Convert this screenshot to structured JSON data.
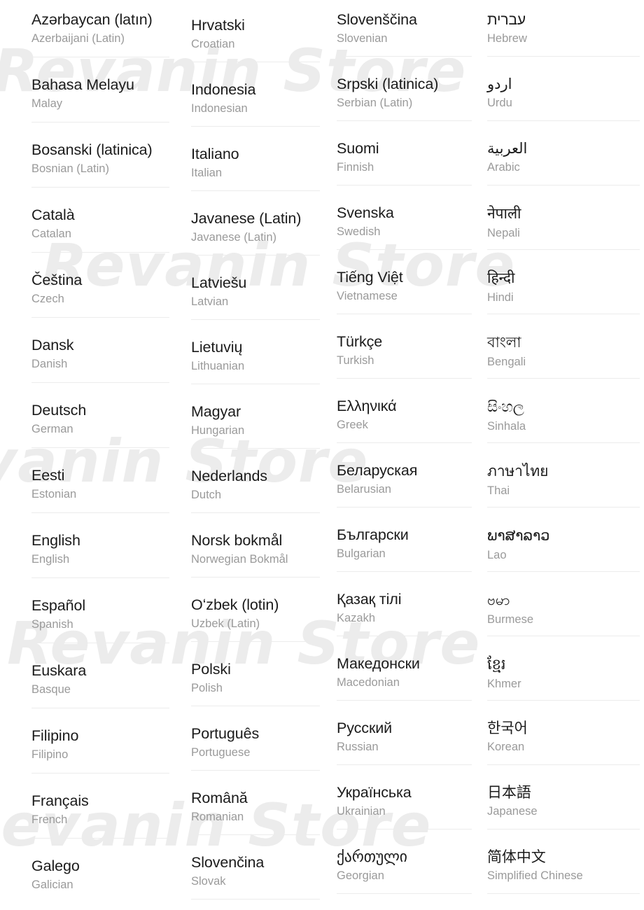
{
  "screen": {
    "title": "Language selection list",
    "watermark_text": "Revanin Store",
    "colors": {
      "background": "#ffffff",
      "native_text": "#1b1b1b",
      "english_text": "#9a9a9a",
      "divider": "#ececec",
      "watermark": "#d8d8d8"
    }
  },
  "watermarks": [
    {
      "text": "Revanin Store"
    },
    {
      "text": "Revanin Store"
    },
    {
      "text": "Revanin Store"
    },
    {
      "text": "Revanin Store"
    },
    {
      "text": "Revanin Store"
    }
  ],
  "columns": [
    {
      "id": "column-1",
      "items": [
        {
          "native": "Azərbaycan (latın)",
          "english": "Azerbaijani (Latin)",
          "script": "latin"
        },
        {
          "native": "Bahasa Melayu",
          "english": "Malay",
          "script": "latin"
        },
        {
          "native": "Bosanski (latinica)",
          "english": "Bosnian (Latin)",
          "script": "latin"
        },
        {
          "native": "Català",
          "english": "Catalan",
          "script": "latin"
        },
        {
          "native": "Čeština",
          "english": "Czech",
          "script": "latin"
        },
        {
          "native": "Dansk",
          "english": "Danish",
          "script": "latin"
        },
        {
          "native": "Deutsch",
          "english": "German",
          "script": "latin"
        },
        {
          "native": "Eesti",
          "english": "Estonian",
          "script": "latin"
        },
        {
          "native": "English",
          "english": "English",
          "script": "latin"
        },
        {
          "native": "Español",
          "english": "Spanish",
          "script": "latin"
        },
        {
          "native": "Euskara",
          "english": "Basque",
          "script": "latin"
        },
        {
          "native": "Filipino",
          "english": "Filipino",
          "script": "latin"
        },
        {
          "native": "Français",
          "english": "French",
          "script": "latin"
        },
        {
          "native": "Galego",
          "english": "Galician",
          "script": "latin"
        }
      ]
    },
    {
      "id": "column-2",
      "items": [
        {
          "native": "Hrvatski",
          "english": "Croatian",
          "script": "latin"
        },
        {
          "native": "Indonesia",
          "english": "Indonesian",
          "script": "latin"
        },
        {
          "native": "Italiano",
          "english": "Italian",
          "script": "latin"
        },
        {
          "native": "Javanese (Latin)",
          "english": "Javanese (Latin)",
          "script": "latin"
        },
        {
          "native": "Latviešu",
          "english": "Latvian",
          "script": "latin"
        },
        {
          "native": "Lietuvių",
          "english": "Lithuanian",
          "script": "latin"
        },
        {
          "native": "Magyar",
          "english": "Hungarian",
          "script": "latin"
        },
        {
          "native": "Nederlands",
          "english": "Dutch",
          "script": "latin"
        },
        {
          "native": "Norsk bokmål",
          "english": "Norwegian Bokmål",
          "script": "latin"
        },
        {
          "native": "Oʻzbek (lotin)",
          "english": "Uzbek (Latin)",
          "script": "latin"
        },
        {
          "native": "Polski",
          "english": "Polish",
          "script": "latin"
        },
        {
          "native": "Português",
          "english": "Portuguese",
          "script": "latin"
        },
        {
          "native": "Română",
          "english": "Romanian",
          "script": "latin"
        },
        {
          "native": "Slovenčina",
          "english": "Slovak",
          "script": "latin"
        }
      ]
    },
    {
      "id": "column-3",
      "items": [
        {
          "native": "Slovenščina",
          "english": "Slovenian",
          "script": "latin"
        },
        {
          "native": "Srpski (latinica)",
          "english": "Serbian (Latin)",
          "script": "latin"
        },
        {
          "native": "Suomi",
          "english": "Finnish",
          "script": "latin"
        },
        {
          "native": "Svenska",
          "english": "Swedish",
          "script": "latin"
        },
        {
          "native": "Tiếng Việt",
          "english": "Vietnamese",
          "script": "latin"
        },
        {
          "native": "Türkçe",
          "english": "Turkish",
          "script": "latin"
        },
        {
          "native": "Ελληνικά",
          "english": "Greek",
          "script": "greek"
        },
        {
          "native": "Беларуская",
          "english": "Belarusian",
          "script": "cyrillic"
        },
        {
          "native": "Български",
          "english": "Bulgarian",
          "script": "cyrillic"
        },
        {
          "native": "Қазақ тілі",
          "english": "Kazakh",
          "script": "cyrillic"
        },
        {
          "native": "Македонски",
          "english": "Macedonian",
          "script": "cyrillic"
        },
        {
          "native": "Русский",
          "english": "Russian",
          "script": "cyrillic"
        },
        {
          "native": "Українська",
          "english": "Ukrainian",
          "script": "cyrillic"
        },
        {
          "native": "ქართული",
          "english": "Georgian",
          "script": "georgian"
        }
      ]
    },
    {
      "id": "column-4",
      "items": [
        {
          "native": "עברית",
          "english": "Hebrew",
          "script": "rtl"
        },
        {
          "native": "اردو",
          "english": "Urdu",
          "script": "rtl"
        },
        {
          "native": "العربية",
          "english": "Arabic",
          "script": "rtl"
        },
        {
          "native": "नेपाली",
          "english": "Nepali",
          "script": "indic"
        },
        {
          "native": "हिन्दी",
          "english": "Hindi",
          "script": "indic"
        },
        {
          "native": "বাংলা",
          "english": "Bengali",
          "script": "indic"
        },
        {
          "native": "සිංහල",
          "english": "Sinhala",
          "script": "indic"
        },
        {
          "native": "ภาษาไทย",
          "english": "Thai",
          "script": "sea"
        },
        {
          "native": "ພາສາລາວ",
          "english": "Lao",
          "script": "sea"
        },
        {
          "native": "ဗမာ",
          "english": "Burmese",
          "script": "sea"
        },
        {
          "native": "ខ្មែរ",
          "english": "Khmer",
          "script": "sea"
        },
        {
          "native": "한국어",
          "english": "Korean",
          "script": "cjk"
        },
        {
          "native": "日本語",
          "english": "Japanese",
          "script": "cjk"
        },
        {
          "native": "简体中文",
          "english": "Simplified Chinese",
          "script": "cjk"
        }
      ]
    }
  ]
}
